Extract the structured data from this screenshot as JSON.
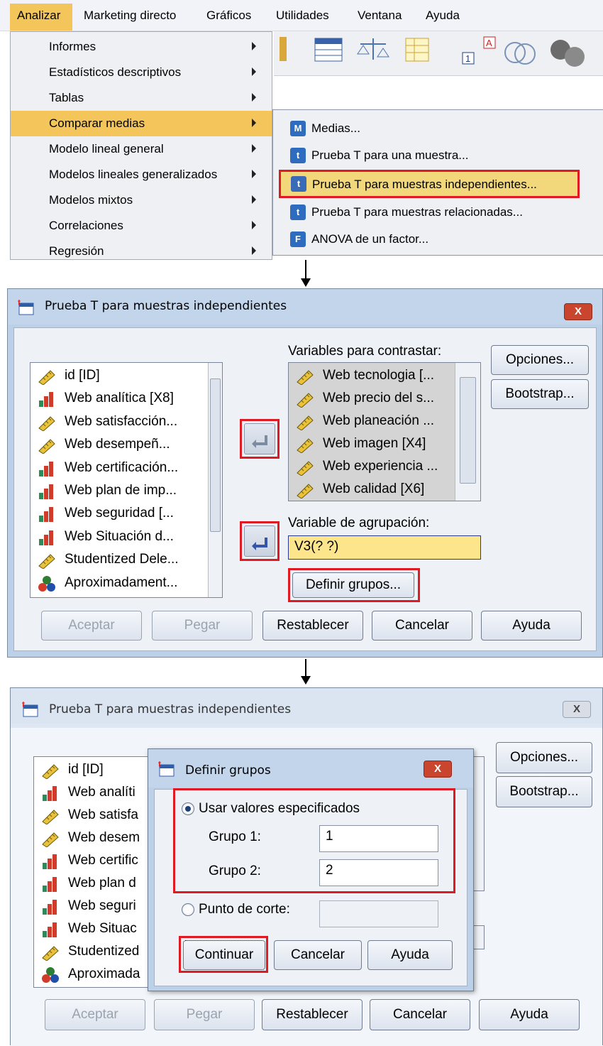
{
  "menubar": {
    "items": [
      "Analizar",
      "Marketing directo",
      "Gráficos",
      "Utilidades",
      "Ventana",
      "Ayuda"
    ]
  },
  "analizar_menu": {
    "items": [
      "Informes",
      "Estadísticos descriptivos",
      "Tablas",
      "Comparar medias",
      "Modelo lineal general",
      "Modelos lineales generalizados",
      "Modelos mixtos",
      "Correlaciones",
      "Regresión"
    ],
    "highlighted": "Comparar medias"
  },
  "submenu": {
    "items": [
      {
        "label": "Medias...",
        "icon": "M"
      },
      {
        "label": "Prueba T para una muestra...",
        "icon": "t"
      },
      {
        "label": "Prueba T para muestras independientes...",
        "icon": "t"
      },
      {
        "label": "Prueba T para muestras relacionadas...",
        "icon": "t"
      },
      {
        "label": "ANOVA de un factor...",
        "icon": "F"
      }
    ],
    "selected": "Prueba T para muestras independientes..."
  },
  "dialog1": {
    "title": "Prueba T para muestras independientes",
    "close": "X",
    "source_vars": [
      {
        "label": "id [ID]",
        "type": "scale"
      },
      {
        "label": "Web analítica [X8]",
        "type": "ordinal"
      },
      {
        "label": "Web satisfacción...",
        "type": "scale"
      },
      {
        "label": "Web desempeñ...",
        "type": "scale"
      },
      {
        "label": "Web certificación...",
        "type": "ordinal"
      },
      {
        "label": "Web plan de imp...",
        "type": "ordinal"
      },
      {
        "label": "Web seguridad [...",
        "type": "ordinal"
      },
      {
        "label": "Web Situación d...",
        "type": "ordinal"
      },
      {
        "label": "Studentized Dele...",
        "type": "scale"
      },
      {
        "label": "Aproximadament...",
        "type": "nominal"
      }
    ],
    "test_vars_label": "Variables para contrastar:",
    "test_vars": [
      "Web tecnologia [...",
      "Web precio del s...",
      "Web planeación ...",
      "Web imagen  [X4]",
      "Web experiencia ...",
      "Web calidad [X6]"
    ],
    "grouping_label": "Variable de agrupación:",
    "grouping_value": "V3(? ?)",
    "define_groups": "Definir grupos...",
    "side_buttons": [
      "Opciones...",
      "Bootstrap..."
    ],
    "bottom_buttons": [
      "Aceptar",
      "Pegar",
      "Restablecer",
      "Cancelar",
      "Ayuda"
    ]
  },
  "dialog2": {
    "title": "Prueba T para muestras independientes",
    "close": "X",
    "source_vars": [
      {
        "label": "id [ID]",
        "type": "scale"
      },
      {
        "label": "Web analíti",
        "type": "ordinal"
      },
      {
        "label": "Web satisfa",
        "type": "scale"
      },
      {
        "label": "Web desem",
        "type": "scale"
      },
      {
        "label": "Web certific",
        "type": "ordinal"
      },
      {
        "label": "Web plan d",
        "type": "ordinal"
      },
      {
        "label": "Web seguri",
        "type": "ordinal"
      },
      {
        "label": "Web Situac",
        "type": "ordinal"
      },
      {
        "label": "Studentized",
        "type": "scale"
      },
      {
        "label": "Aproximada",
        "type": "nominal"
      }
    ],
    "side_buttons": [
      "Opciones...",
      "Bootstrap..."
    ],
    "bottom_buttons": [
      "Aceptar",
      "Pegar",
      "Restablecer",
      "Cancelar",
      "Ayuda"
    ]
  },
  "define_groups_dialog": {
    "title": "Definir grupos",
    "close": "X",
    "use_specified": "Usar valores especificados",
    "group1_label": "Grupo 1:",
    "group1_value": "1",
    "group2_label": "Grupo 2:",
    "group2_value": "2",
    "cut_point": "Punto de corte:",
    "buttons": [
      "Continuar",
      "Cancelar",
      "Ayuda"
    ]
  },
  "colors": {
    "menu_highlight": "#f4c55a",
    "red_frame": "#e01a22",
    "dialog_bg": "#bcd0e8"
  }
}
